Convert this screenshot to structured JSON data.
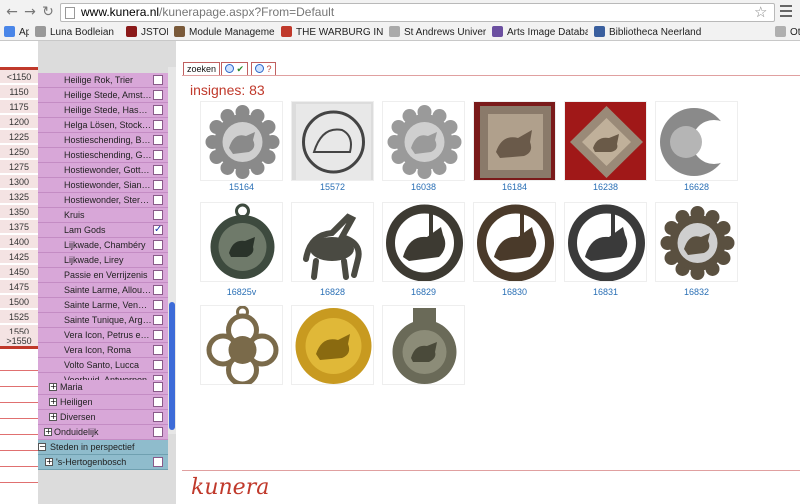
{
  "browser": {
    "url_host": "www.kunera.nl",
    "url_path": "/kunerapage.aspx?From=Default",
    "bookmarks": [
      {
        "label": "Apps",
        "color": "#4a86e8"
      },
      {
        "label": "Luna Bodleian",
        "color": "#999999"
      },
      {
        "label": "JSTOR",
        "color": "#8b1a1a"
      },
      {
        "label": "Module Management",
        "color": "#7a5a3a"
      },
      {
        "label": "THE WARBURG INSTI",
        "color": "#c0392b"
      },
      {
        "label": "St Andrews Universi",
        "color": "#aaaaaa"
      },
      {
        "label": "Arts Image Database",
        "color": "#6b4fa0"
      },
      {
        "label": "Bibliotheca Neerland",
        "color": "#3a5f9e"
      },
      {
        "label": "Oth",
        "color": "#b0b0b0"
      }
    ]
  },
  "timeline": {
    "top_label": "<1150",
    "years": [
      "1150",
      "1175",
      "1200",
      "1225",
      "1250",
      "1275",
      "1300",
      "1325",
      "1350",
      "1375",
      "1400",
      "1425",
      "1450",
      "1475",
      "1500",
      "1525",
      "1550"
    ],
    "bottom_label": ">1550"
  },
  "categories": [
    {
      "label": "Heilige Rok, Trier",
      "checked": false
    },
    {
      "label": "Heilige Stede, Amsterdam",
      "checked": false
    },
    {
      "label": "Heilige Stede, Hasselt",
      "checked": false
    },
    {
      "label": "Helga Lösen, Stockholm",
      "checked": false
    },
    {
      "label": "Hostieschending, Biombe",
      "checked": false
    },
    {
      "label": "Hostieschending, Güstro",
      "checked": false
    },
    {
      "label": "Hostiewonder, Gottsbüre",
      "checked": false
    },
    {
      "label": "Hostiewonder, Sianów",
      "checked": false
    },
    {
      "label": "Hostiewonder, Sternberg",
      "checked": false
    },
    {
      "label": "Kruis",
      "checked": false
    },
    {
      "label": "Lam Gods",
      "checked": true
    },
    {
      "label": "Lijkwade, Chambéry",
      "checked": false
    },
    {
      "label": "Lijkwade, Lirey",
      "checked": false
    },
    {
      "label": "Passie en Verrijzenis",
      "checked": false
    },
    {
      "label": "Sainte Larme, Allouagne",
      "checked": false
    },
    {
      "label": "Sainte Larme, Vendôme",
      "checked": false
    },
    {
      "label": "Sainte Tunique, Argenteuil",
      "checked": false
    },
    {
      "label": "Vera Icon, Petrus en Paulus",
      "checked": false
    },
    {
      "label": "Vera Icon, Roma",
      "checked": false
    },
    {
      "label": "Volto Santo, Lucca",
      "checked": false
    },
    {
      "label": "Voorhuid, Antwerpen",
      "checked": false
    }
  ],
  "groups": [
    {
      "label": "Maria",
      "checked": false
    },
    {
      "label": "Heiligen",
      "checked": false
    },
    {
      "label": "Diversen",
      "checked": false
    }
  ],
  "top_groups": [
    {
      "label": "Onduidelijk",
      "checked": false
    }
  ],
  "places": {
    "section_label": "Steden in perspectief",
    "item_label": "'s-Hertogenbosch"
  },
  "tabs": {
    "search_label": "zoeken",
    "check_label": "✔",
    "help_label": "?"
  },
  "results": {
    "count_label": "insignes: 83",
    "items": [
      {
        "id": "15164",
        "tone": "#8a8a8a",
        "bg": "#ffffff",
        "shape": "rosette"
      },
      {
        "id": "15572",
        "tone": "#444444",
        "bg": "#dcdcdc",
        "shape": "sketch"
      },
      {
        "id": "16038",
        "tone": "#9a9a9a",
        "bg": "#ffffff",
        "shape": "rosette"
      },
      {
        "id": "16184",
        "tone": "#8a7a6a",
        "bg": "#7a1a1a",
        "shape": "square"
      },
      {
        "id": "16238",
        "tone": "#9a8a78",
        "bg": "#a01818",
        "shape": "diamond"
      },
      {
        "id": "16628",
        "tone": "#8a8a8a",
        "bg": "#ffffff",
        "shape": "crescent"
      },
      {
        "id": "16825v",
        "tone": "#3d4a3e",
        "bg": "#ffffff",
        "shape": "pendant"
      },
      {
        "id": "16828",
        "tone": "#4a4a42",
        "bg": "#ffffff",
        "shape": "lamb"
      },
      {
        "id": "16829",
        "tone": "#3d3a32",
        "bg": "#ffffff",
        "shape": "ring"
      },
      {
        "id": "16830",
        "tone": "#4a3a2a",
        "bg": "#ffffff",
        "shape": "ring"
      },
      {
        "id": "16831",
        "tone": "#3a3a3a",
        "bg": "#ffffff",
        "shape": "ring"
      },
      {
        "id": "16832",
        "tone": "#5a5040",
        "bg": "#ffffff",
        "shape": "rosette"
      },
      {
        "id": "",
        "tone": "#7a6a4a",
        "bg": "#ffffff",
        "shape": "quatrefoil"
      },
      {
        "id": "",
        "tone": "#c89a20",
        "bg": "#ffffff",
        "shape": "gold"
      },
      {
        "id": "",
        "tone": "#6a6a58",
        "bg": "#ffffff",
        "shape": "ampulla"
      }
    ]
  },
  "brand": "kunera"
}
